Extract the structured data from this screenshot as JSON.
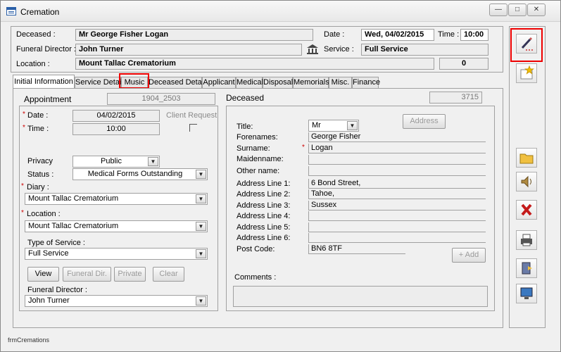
{
  "window": {
    "title": "Cremation",
    "minimize": "—",
    "maximize": "□",
    "close": "✕"
  },
  "header": {
    "deceased_label": "Deceased :",
    "deceased_value": "Mr George Fisher Logan",
    "date_label": "Date  :",
    "date_value": "Wed, 04/02/2015",
    "time_label": "Time :",
    "time_value": "10:00",
    "director_label": "Funeral Director :",
    "director_value": "John Turner",
    "service_label": "Service :",
    "service_value": "Full Service",
    "location_label": "Location :",
    "location_value": "Mount Tallac Crematorium",
    "count_value": "0"
  },
  "tabs": [
    "Initial Information",
    "Service Details",
    "Music",
    "Deceased Details",
    "Applicant",
    "Medical",
    "Disposal",
    "Memorials",
    "Misc.",
    "Finance"
  ],
  "appointment": {
    "label": "Appointment",
    "number": "1904_2503",
    "date_label": "Date :",
    "date_value": "04/02/2015",
    "time_label": "Time :",
    "time_value": "10:00",
    "client_request": "Client Request",
    "privacy_label": "Privacy",
    "privacy_value": "Public",
    "status_label": "Status :",
    "status_value": "Medical Forms Outstanding",
    "diary_label": "Diary :",
    "diary_value": "Mount Tallac Crematorium",
    "location_label": "Location :",
    "location_value": "Mount Tallac Crematorium",
    "service_type_label": "Type of Service  :",
    "service_type_value": "Full Service",
    "buttons": {
      "view": "View",
      "funeral_dir": "Funeral Dir.",
      "private": "Private",
      "clear": "Clear"
    },
    "director_label": "Funeral Director :",
    "director_value": "John Turner"
  },
  "deceased": {
    "label": "Deceased",
    "number": "3715",
    "address_button": "Address",
    "title_label": "Title:",
    "title_value": "Mr",
    "forenames_label": "Forenames:",
    "forenames_value": "George Fisher",
    "surname_label": "Surname:",
    "surname_value": "Logan",
    "maidenname_label": "Maidenname:",
    "maidenname_value": "",
    "other_label": "Other name:",
    "other_value": "",
    "addr1_label": "Address Line 1:",
    "addr1_value": "6 Bond Street,",
    "addr2_label": "Address Line 2:",
    "addr2_value": "Tahoe,",
    "addr3_label": "Address Line 3:",
    "addr3_value": "Sussex",
    "addr4_label": "Address Line 4:",
    "addr4_value": "",
    "addr5_label": "Address Line 5:",
    "addr5_value": "",
    "addr6_label": "Address Line 6:",
    "addr6_value": "",
    "postcode_label": "Post Code:",
    "postcode_value": "BN6 8TF",
    "add_button": "+ Add",
    "comments_label": "Comments :",
    "comments_value": ""
  },
  "sidebar_icons": [
    "edit-pencil-icon",
    "new-star-icon",
    "folder-icon",
    "speaker-icon",
    "delete-x-icon",
    "print-icon",
    "exit-door-icon",
    "monitor-icon"
  ],
  "status_bar": "frmCremations",
  "colors": {
    "highlight": "#e00000",
    "required": "#cc0000"
  }
}
